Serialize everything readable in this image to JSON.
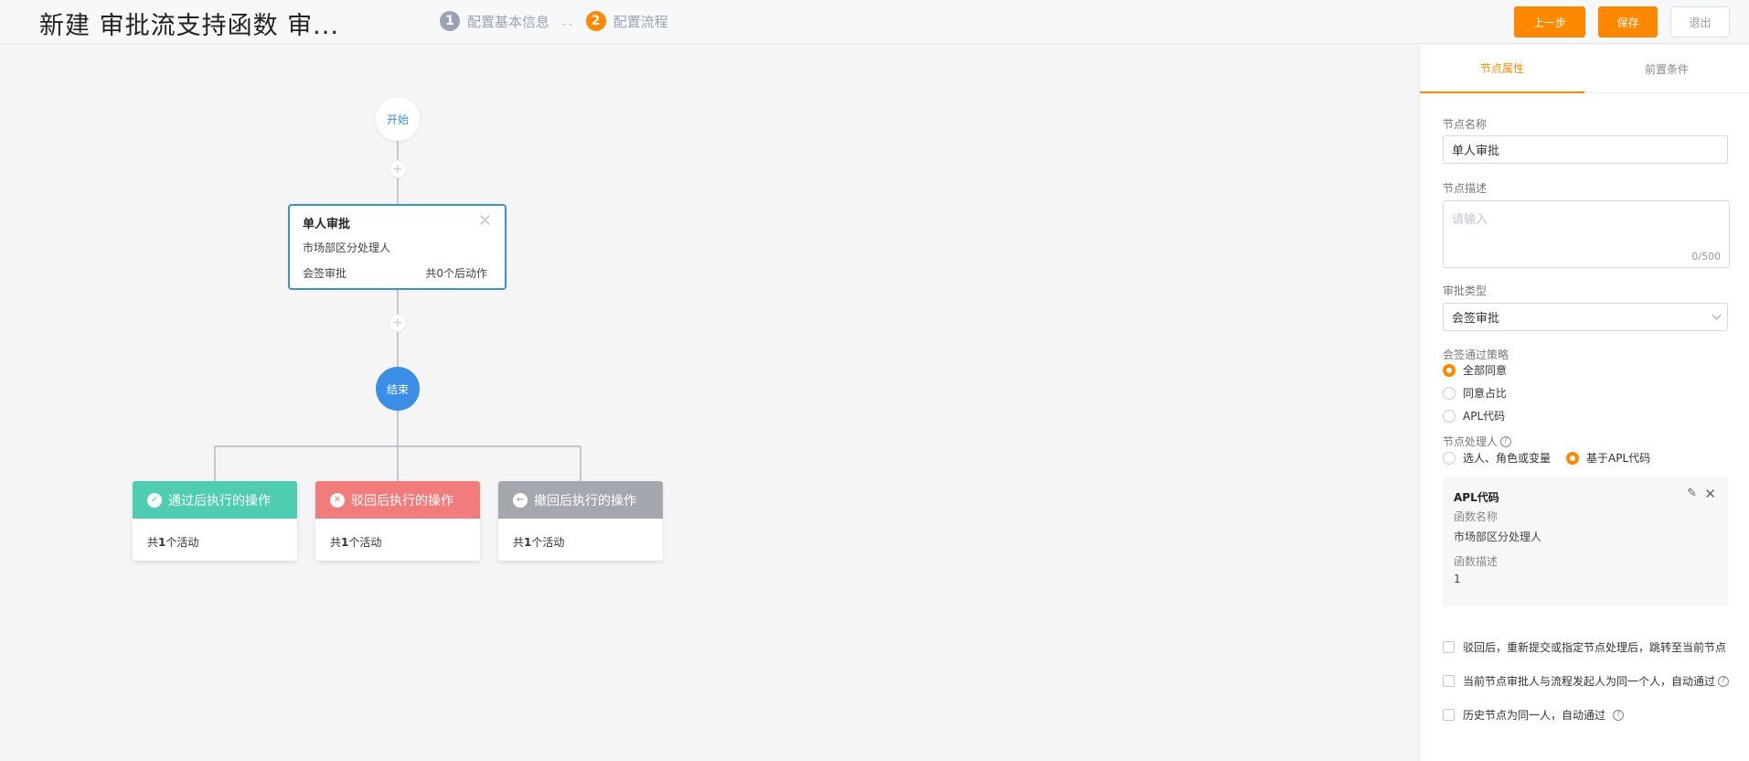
{
  "header": {
    "title": "新建 审批流支持函数 审...",
    "steps": [
      {
        "num": "1",
        "label": "配置基本信息"
      },
      {
        "num": "2",
        "label": "配置流程"
      }
    ],
    "step_separator": "..",
    "buttons": {
      "prev": "上一步",
      "save": "保存",
      "exit": "退出"
    }
  },
  "flow": {
    "start_label": "开始",
    "end_label": "结束",
    "plus_symbol": "+",
    "approval_node": {
      "title": "单人审批",
      "handler": "市场部区分处理人",
      "type": "会签审批",
      "after_actions": "共0个后动作"
    },
    "action_cards": [
      {
        "label": "通过后执行的操作",
        "count_prefix": "共",
        "count": "1",
        "count_suffix": "个活动",
        "color": "#4ecdb1"
      },
      {
        "label": "驳回后执行的操作",
        "count_prefix": "共",
        "count": "1",
        "count_suffix": "个活动",
        "color": "#f27b7b"
      },
      {
        "label": "撤回后执行的操作",
        "count_prefix": "共",
        "count": "1",
        "count_suffix": "个活动",
        "color": "#a5a7ae"
      }
    ]
  },
  "panel": {
    "tabs": [
      "节点属性",
      "前置条件"
    ],
    "node_name_label": "节点名称",
    "node_name_value": "单人审批",
    "node_desc_label": "节点描述",
    "node_desc_placeholder": "请输入",
    "node_desc_count": "0/500",
    "approve_type_label": "审批类型",
    "approve_type_value": "会签审批",
    "pass_strategy_label": "会签通过策略",
    "pass_strategy_options": [
      "全部同意",
      "同意占比",
      "APL代码"
    ],
    "pass_strategy_selected": 0,
    "handler_label": "节点处理人",
    "handler_options": [
      "选人、角色或变量",
      "基于APL代码"
    ],
    "handler_selected": 1,
    "apl": {
      "title": "APL代码",
      "func_name_label": "函数名称",
      "func_name_value": "市场部区分处理人",
      "func_desc_label": "函数描述",
      "func_desc_value": "1"
    },
    "checkboxes": [
      {
        "label": "驳回后，重新提交或指定节点处理后，跳转至当前节点",
        "help": false
      },
      {
        "label": "当前节点审批人与流程发起人为同一个人，自动通过",
        "help": true
      },
      {
        "label": "历史节点为同一人，自动通过",
        "help": true
      }
    ],
    "help_symbol": "?"
  },
  "colors": {
    "accent": "#ff8800",
    "node_blue": "#3a8ee6"
  }
}
